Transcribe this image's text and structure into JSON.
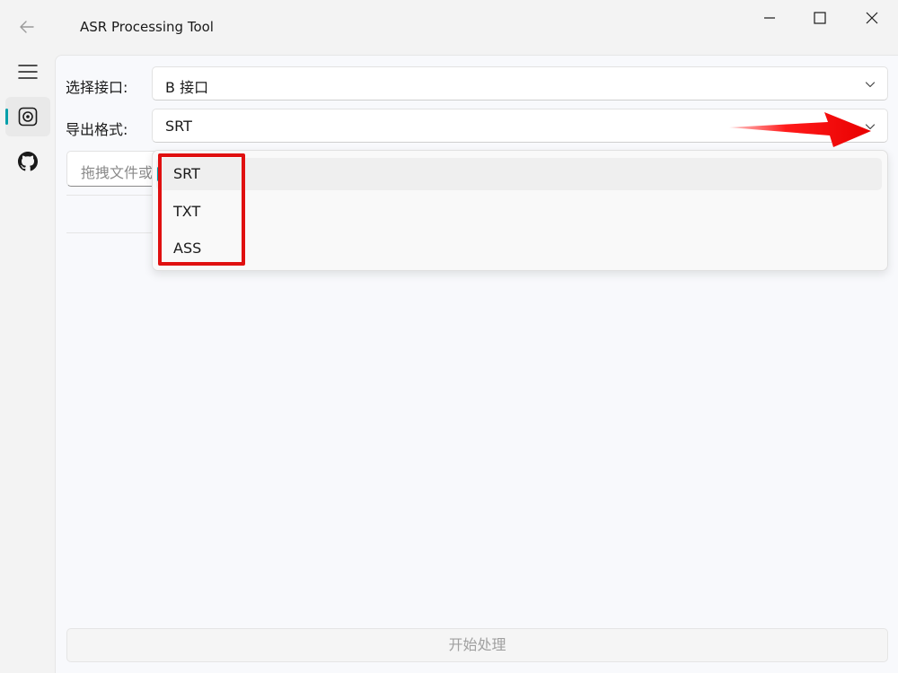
{
  "window": {
    "title": "ASR Processing Tool"
  },
  "nav": {
    "items": [
      {
        "icon": "menu-icon"
      },
      {
        "icon": "asr-icon",
        "selected": true
      },
      {
        "icon": "github-icon"
      }
    ]
  },
  "form": {
    "api_label": "选择接口:",
    "api_value": "B 接口",
    "format_label": "导出格式:",
    "format_value": "SRT",
    "file_placeholder": "拖拽文件或"
  },
  "dropdown": {
    "options": [
      "SRT",
      "TXT",
      "ASS"
    ],
    "selected": "SRT"
  },
  "actions": {
    "start_label": "开始处理"
  },
  "colors": {
    "accent": "#009faa",
    "annotation": "#e01010"
  }
}
